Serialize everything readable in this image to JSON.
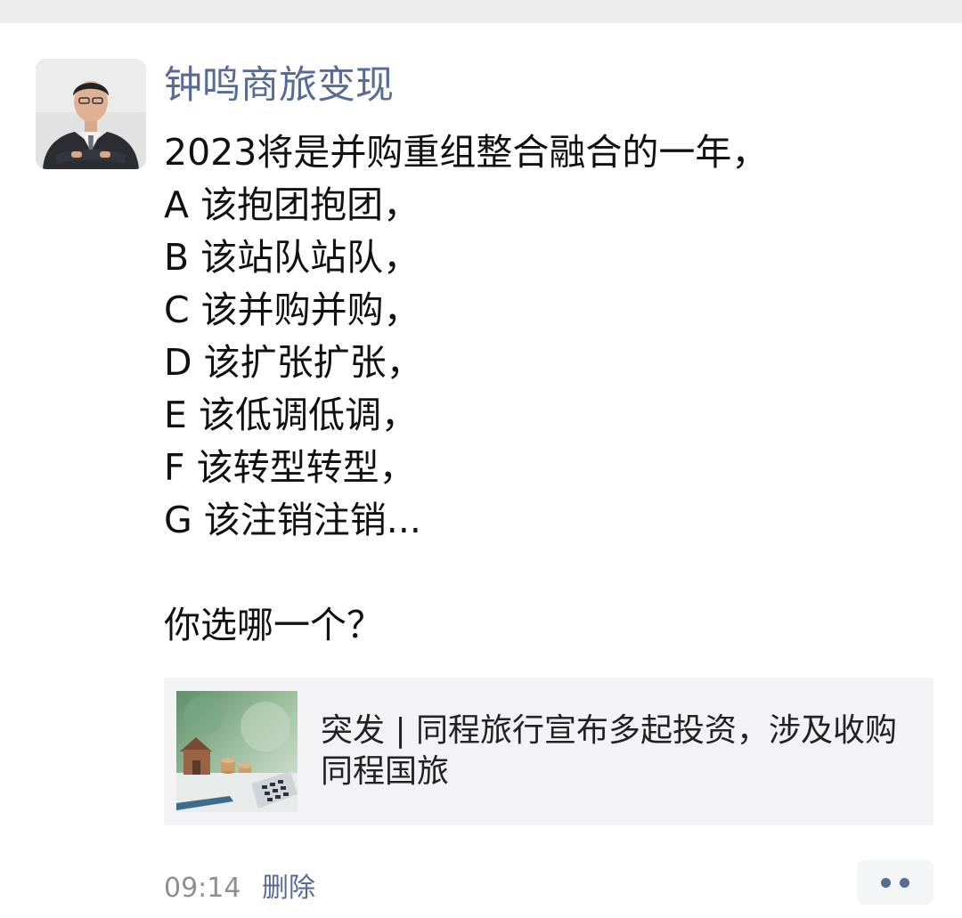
{
  "post": {
    "author": "钟鸣商旅变现",
    "lines": [
      "2023将是并购重组整合融合的一年，",
      "A 该抱团抱团，",
      "B 该站队站队，",
      "C 该并购并购，",
      "D 该扩张扩张，",
      "E 该低调低调，",
      "F 该转型转型，",
      "G 该注销注销...",
      "",
      "你选哪一个？"
    ],
    "link": {
      "title": "突发 | 同程旅行宣布多起投资，涉及收购同程国旅"
    },
    "footer": {
      "time": "09:14",
      "delete_label": "删除"
    }
  },
  "colors": {
    "author_name": "#576b95",
    "body_text": "#111111",
    "card_background": "#f3f3f5",
    "meta_text": "#8f8f8f"
  },
  "icons": {
    "more": "more-dots-icon"
  }
}
